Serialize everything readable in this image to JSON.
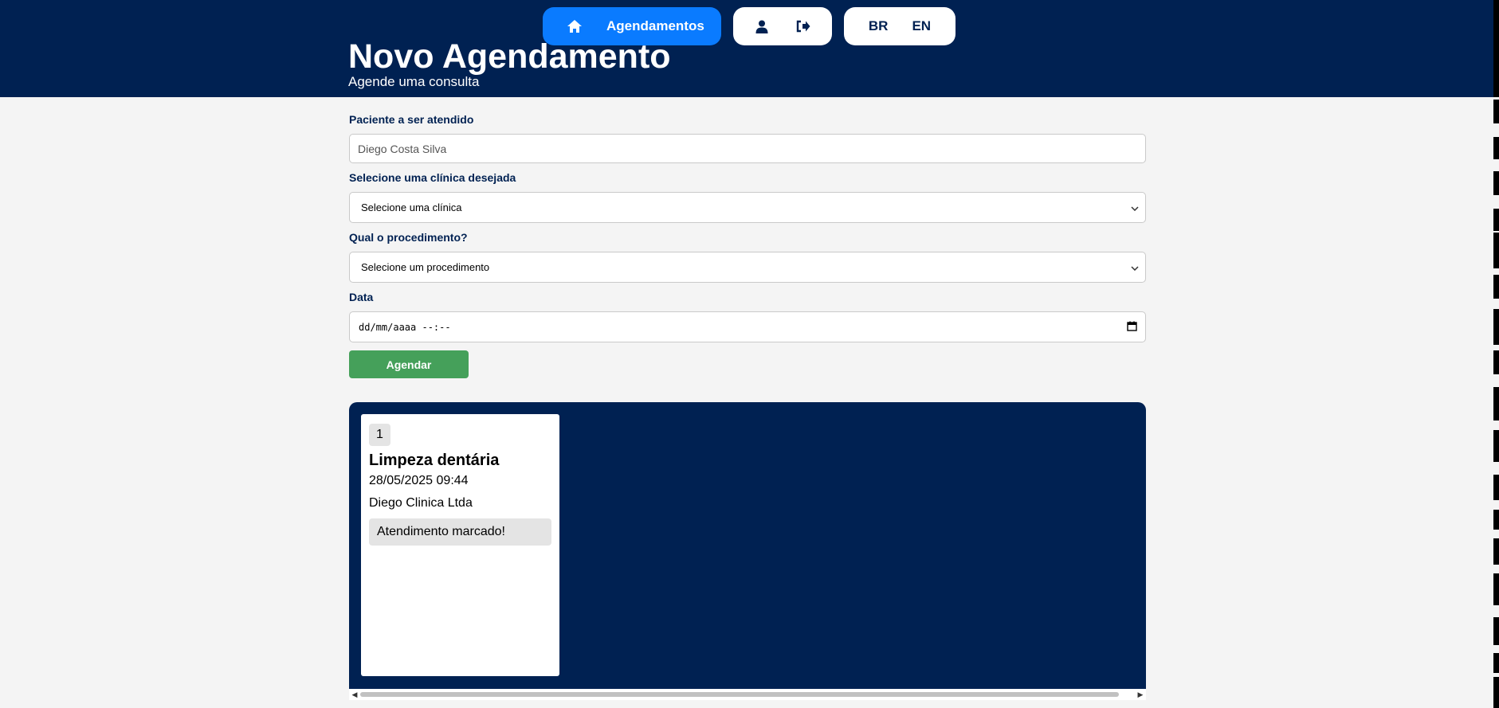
{
  "nav": {
    "home_label": "Agendamentos",
    "home_icon": "home-icon",
    "user_icon": "user-icon",
    "logout_icon": "logout-icon",
    "lang_br": "BR",
    "lang_en": "EN"
  },
  "header": {
    "title": "Novo Agendamento",
    "subtitle": "Agende uma consulta"
  },
  "form": {
    "patient_label": "Paciente a ser atendido",
    "patient_value": "Diego Costa Silva",
    "clinic_label": "Selecione uma clínica desejada",
    "clinic_selected": "Selecione uma clínica",
    "procedure_label": "Qual o procedimento?",
    "procedure_selected": "Selecione um procedimento",
    "date_label": "Data",
    "date_placeholder": "dd/mm/aaaa --:--",
    "submit_label": "Agendar"
  },
  "appointments": [
    {
      "index": "1",
      "procedure": "Limpeza dentária",
      "datetime": "28/05/2025 09:44",
      "clinic": "Diego Clinica Ltda",
      "status": "Atendimento marcado!"
    }
  ],
  "colors": {
    "header_bg": "#002152",
    "accent_blue": "#0a7bff",
    "submit_green": "#45a05a",
    "page_bg": "#f4f4f4"
  }
}
